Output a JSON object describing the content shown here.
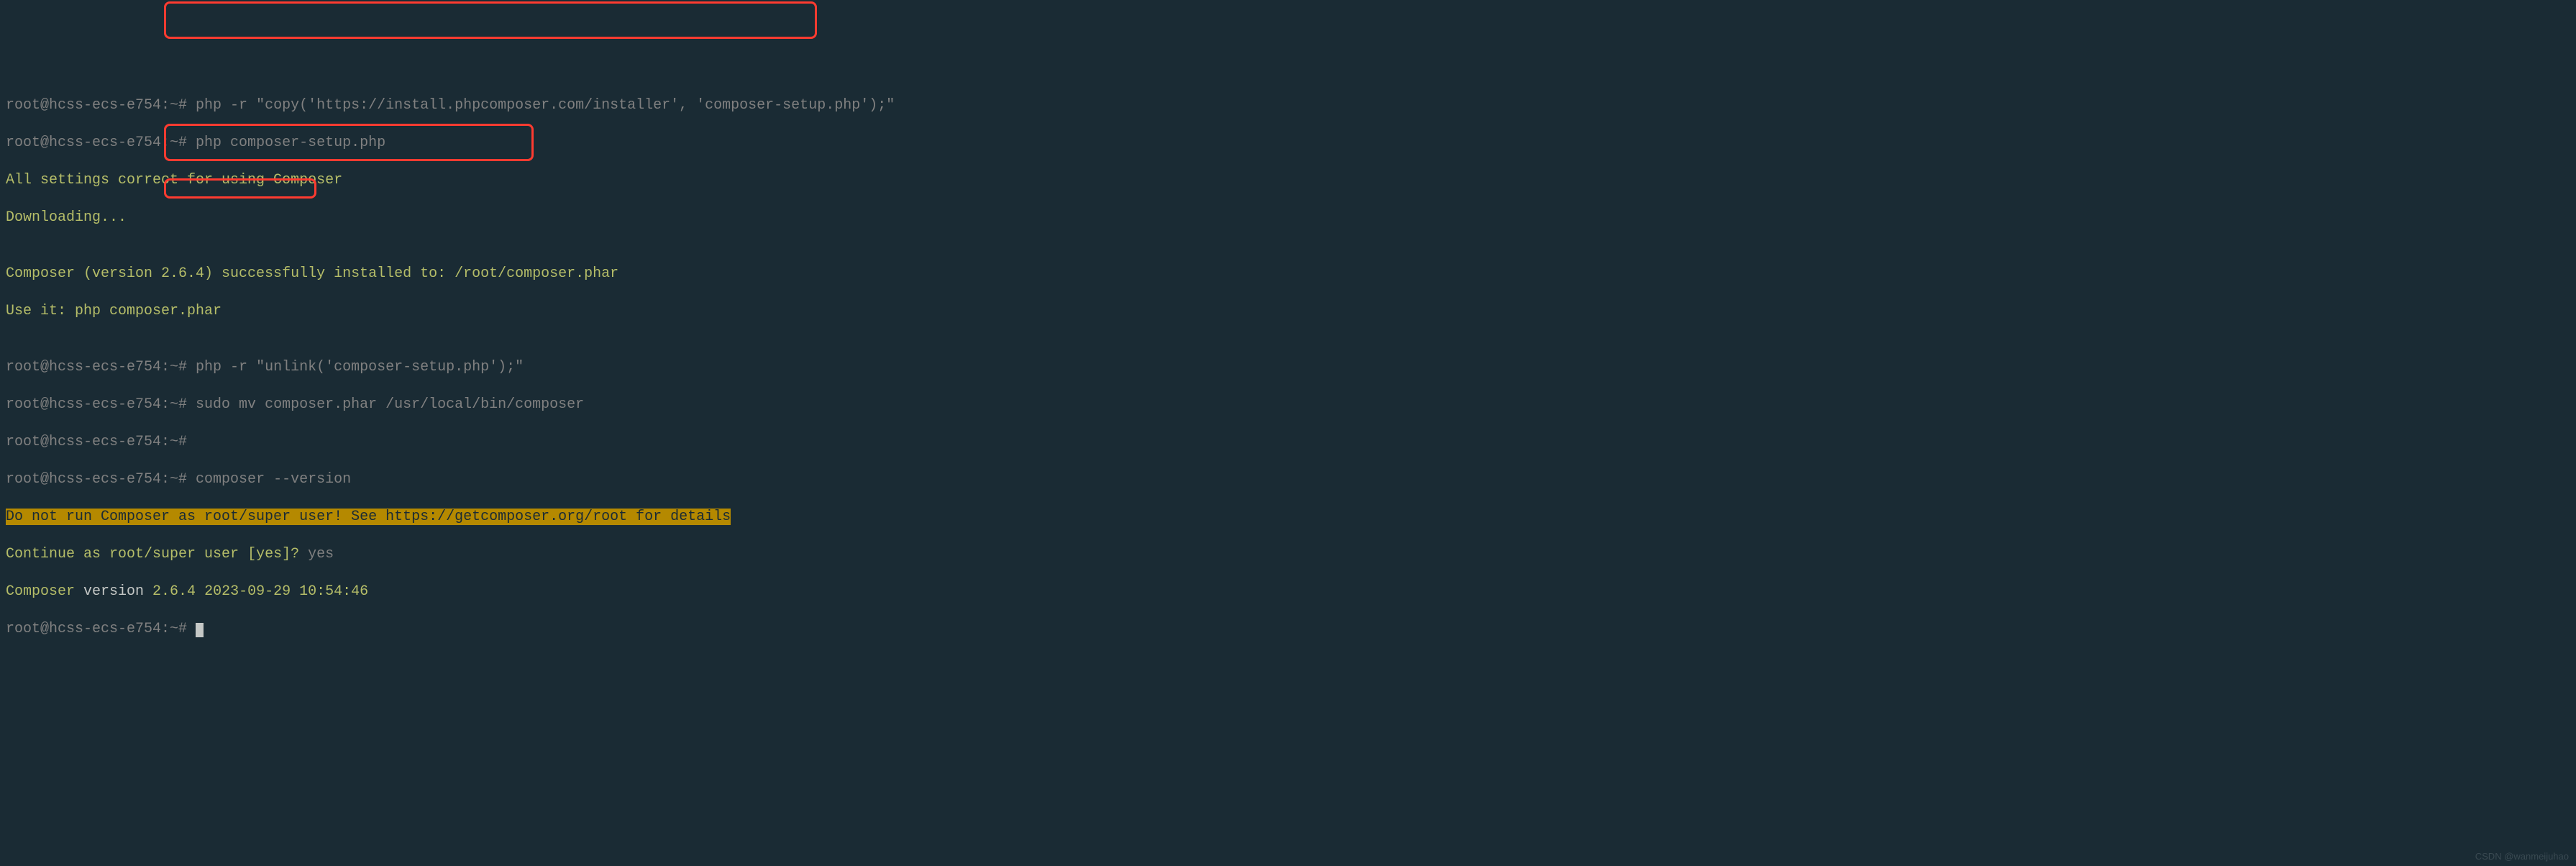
{
  "prompt": "root@hcss-ecs-e754:~#",
  "lines": {
    "l1_cmd": " php -r \"copy('https://install.phpcomposer.com/installer', 'composer-setup.php');\"",
    "l2_cmd": " php composer-setup.php",
    "l3": "All settings correct for using Composer",
    "l4": "Downloading...",
    "l5": "",
    "l6": "Composer (version 2.6.4) successfully installed to: /root/composer.phar",
    "l7": "Use it: php composer.phar",
    "l8": "",
    "l9_cmd": " php -r \"unlink('composer-setup.php');\"",
    "l10_cmd": " sudo mv composer.phar /usr/local/bin/composer",
    "l11_cmd": "",
    "l12_cmd": " composer --version",
    "l13": "Do not run Composer as root/super user! See https://getcomposer.org/root for details",
    "l14_a": "Continue as root/super user ",
    "l14_b": "[yes]",
    "l14_c": "? ",
    "l14_d": "yes",
    "l15_a": "Composer",
    "l15_b": " version ",
    "l15_c": "2.6.4",
    "l15_d": " 2023-09-29 10:54:46",
    "l16_cmd": " "
  },
  "watermark": "CSDN @wanmeijuhao"
}
